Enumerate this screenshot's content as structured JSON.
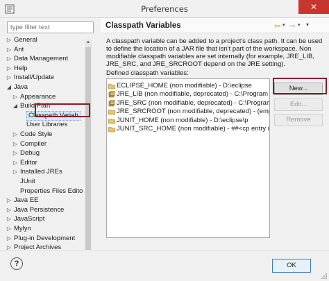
{
  "window": {
    "title": "Preferences",
    "close_glyph": "✕"
  },
  "filter": {
    "placeholder": "type filter text"
  },
  "tree": [
    {
      "label": "General",
      "level": 0,
      "toggle": "▷"
    },
    {
      "label": "Ant",
      "level": 0,
      "toggle": "▷"
    },
    {
      "label": "Data Management",
      "level": 0,
      "toggle": "▷"
    },
    {
      "label": "Help",
      "level": 0,
      "toggle": "▷"
    },
    {
      "label": "Install/Update",
      "level": 0,
      "toggle": "▷"
    },
    {
      "label": "Java",
      "level": 0,
      "toggle": "◢"
    },
    {
      "label": "Appearance",
      "level": 1,
      "toggle": "▷"
    },
    {
      "label": "Build Path",
      "level": 1,
      "toggle": "◢"
    },
    {
      "label": "Classpath Variab",
      "level": 2,
      "toggle": "",
      "selected": true
    },
    {
      "label": "User Libraries",
      "level": 2,
      "toggle": ""
    },
    {
      "label": "Code Style",
      "level": 1,
      "toggle": "▷"
    },
    {
      "label": "Compiler",
      "level": 1,
      "toggle": "▷"
    },
    {
      "label": "Debug",
      "level": 1,
      "toggle": "▷"
    },
    {
      "label": "Editor",
      "level": 1,
      "toggle": "▷"
    },
    {
      "label": "Installed JREs",
      "level": 1,
      "toggle": "▷"
    },
    {
      "label": "JUnit",
      "level": 1,
      "toggle": ""
    },
    {
      "label": "Properties Files Edito",
      "level": 1,
      "toggle": ""
    },
    {
      "label": "Java EE",
      "level": 0,
      "toggle": "▷"
    },
    {
      "label": "Java Persistence",
      "level": 0,
      "toggle": "▷"
    },
    {
      "label": "JavaScript",
      "level": 0,
      "toggle": "▷"
    },
    {
      "label": "Mylyn",
      "level": 0,
      "toggle": "▷"
    },
    {
      "label": "Plug-in Development",
      "level": 0,
      "toggle": "▷"
    },
    {
      "label": "Project Archives",
      "level": 0,
      "toggle": "▷"
    }
  ],
  "page": {
    "title": "Classpath Variables",
    "description": "A classpath variable can be added to a project's class path. It can be used to define the location of a JAR file that isn't part of the workspace. Non modifiable classpath variables are set internally (for example, JRE_LIB, JRE_SRC, and JRE_SRCROOT depend on the JRE setting).",
    "defined_label": "Defined classpath variables:",
    "nav_back": "⇦",
    "nav_forward": "⇨",
    "nav_dropdown": "▾"
  },
  "variables": [
    {
      "text": "ECLIPSE_HOME (non modifiable) - D:\\eclipse",
      "icon": "folder"
    },
    {
      "text": "JRE_LIB (non modifiable, deprecated) - C:\\Program Files",
      "icon": "jar"
    },
    {
      "text": "JRE_SRC (non modifiable, deprecated) - C:\\Program Files",
      "icon": "jar"
    },
    {
      "text": "JRE_SRCROOT (non modifiable, deprecated) - (empty)",
      "icon": "folder"
    },
    {
      "text": "JUNIT_HOME (non modifiable) - D:\\eclipse\\p",
      "icon": "folder"
    },
    {
      "text": "JUNIT_SRC_HOME (non modifiable) - ##<cp entry ignor",
      "icon": "folder"
    }
  ],
  "buttons": {
    "new": "New...",
    "edit": "Edit...",
    "remove": "Remove",
    "ok": "OK",
    "help": "?"
  },
  "colors": {
    "highlight": "#8b1a2b",
    "selection": "#d2e8fb",
    "close": "#c7352f"
  }
}
